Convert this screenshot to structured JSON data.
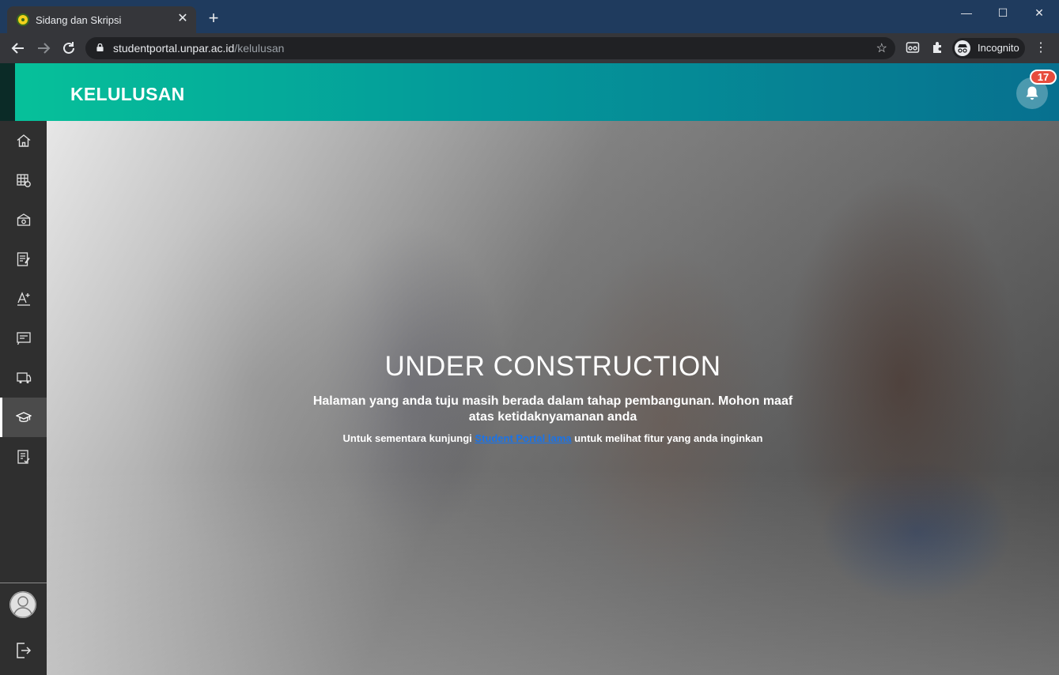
{
  "browser": {
    "tab_title": "Sidang dan Skripsi",
    "tab_close": "✕",
    "new_tab": "+",
    "url_host": "studentportal.unpar.ac.id",
    "url_path": "/kelulusan",
    "profile_label": "Incognito",
    "window_controls": [
      "—",
      "☐",
      "✕"
    ]
  },
  "header": {
    "title": "KELULUSAN",
    "notification_count": "17"
  },
  "sidebar": {
    "items": [
      {
        "icon": "home-icon"
      },
      {
        "icon": "schedule-icon"
      },
      {
        "icon": "finance-icon"
      },
      {
        "icon": "grades-icon"
      },
      {
        "icon": "exam-icon"
      },
      {
        "icon": "presentation-icon"
      },
      {
        "icon": "internship-icon"
      },
      {
        "icon": "graduation-cap-icon",
        "active": true
      },
      {
        "icon": "checklist-icon"
      }
    ]
  },
  "main": {
    "title": "UNDER CONSTRUCTION",
    "message": "Halaman yang anda tuju masih berada dalam tahap pembangunan. Mohon maaf atas ketidaknyamanan anda",
    "link_prefix": "Untuk sementara kunjungi ",
    "link_text": "Student Portal lama",
    "link_suffix": " untuk melihat fitur yang anda inginkan"
  },
  "colors": {
    "header_start": "#06c29a",
    "header_end": "#07708f",
    "badge": "#e74c3c",
    "link": "#1a73e8",
    "sidebar": "#2f2f2f"
  }
}
